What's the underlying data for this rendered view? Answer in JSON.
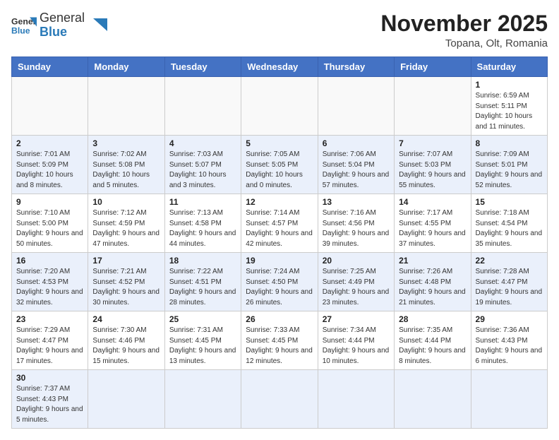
{
  "logo": {
    "text_general": "General",
    "text_blue": "Blue"
  },
  "title": "November 2025",
  "location": "Topana, Olt, Romania",
  "days_of_week": [
    "Sunday",
    "Monday",
    "Tuesday",
    "Wednesday",
    "Thursday",
    "Friday",
    "Saturday"
  ],
  "weeks": [
    [
      {
        "day": "",
        "info": ""
      },
      {
        "day": "",
        "info": ""
      },
      {
        "day": "",
        "info": ""
      },
      {
        "day": "",
        "info": ""
      },
      {
        "day": "",
        "info": ""
      },
      {
        "day": "",
        "info": ""
      },
      {
        "day": "1",
        "info": "Sunrise: 6:59 AM\nSunset: 5:11 PM\nDaylight: 10 hours and 11 minutes."
      }
    ],
    [
      {
        "day": "2",
        "info": "Sunrise: 7:01 AM\nSunset: 5:09 PM\nDaylight: 10 hours and 8 minutes."
      },
      {
        "day": "3",
        "info": "Sunrise: 7:02 AM\nSunset: 5:08 PM\nDaylight: 10 hours and 5 minutes."
      },
      {
        "day": "4",
        "info": "Sunrise: 7:03 AM\nSunset: 5:07 PM\nDaylight: 10 hours and 3 minutes."
      },
      {
        "day": "5",
        "info": "Sunrise: 7:05 AM\nSunset: 5:05 PM\nDaylight: 10 hours and 0 minutes."
      },
      {
        "day": "6",
        "info": "Sunrise: 7:06 AM\nSunset: 5:04 PM\nDaylight: 9 hours and 57 minutes."
      },
      {
        "day": "7",
        "info": "Sunrise: 7:07 AM\nSunset: 5:03 PM\nDaylight: 9 hours and 55 minutes."
      },
      {
        "day": "8",
        "info": "Sunrise: 7:09 AM\nSunset: 5:01 PM\nDaylight: 9 hours and 52 minutes."
      }
    ],
    [
      {
        "day": "9",
        "info": "Sunrise: 7:10 AM\nSunset: 5:00 PM\nDaylight: 9 hours and 50 minutes."
      },
      {
        "day": "10",
        "info": "Sunrise: 7:12 AM\nSunset: 4:59 PM\nDaylight: 9 hours and 47 minutes."
      },
      {
        "day": "11",
        "info": "Sunrise: 7:13 AM\nSunset: 4:58 PM\nDaylight: 9 hours and 44 minutes."
      },
      {
        "day": "12",
        "info": "Sunrise: 7:14 AM\nSunset: 4:57 PM\nDaylight: 9 hours and 42 minutes."
      },
      {
        "day": "13",
        "info": "Sunrise: 7:16 AM\nSunset: 4:56 PM\nDaylight: 9 hours and 39 minutes."
      },
      {
        "day": "14",
        "info": "Sunrise: 7:17 AM\nSunset: 4:55 PM\nDaylight: 9 hours and 37 minutes."
      },
      {
        "day": "15",
        "info": "Sunrise: 7:18 AM\nSunset: 4:54 PM\nDaylight: 9 hours and 35 minutes."
      }
    ],
    [
      {
        "day": "16",
        "info": "Sunrise: 7:20 AM\nSunset: 4:53 PM\nDaylight: 9 hours and 32 minutes."
      },
      {
        "day": "17",
        "info": "Sunrise: 7:21 AM\nSunset: 4:52 PM\nDaylight: 9 hours and 30 minutes."
      },
      {
        "day": "18",
        "info": "Sunrise: 7:22 AM\nSunset: 4:51 PM\nDaylight: 9 hours and 28 minutes."
      },
      {
        "day": "19",
        "info": "Sunrise: 7:24 AM\nSunset: 4:50 PM\nDaylight: 9 hours and 26 minutes."
      },
      {
        "day": "20",
        "info": "Sunrise: 7:25 AM\nSunset: 4:49 PM\nDaylight: 9 hours and 23 minutes."
      },
      {
        "day": "21",
        "info": "Sunrise: 7:26 AM\nSunset: 4:48 PM\nDaylight: 9 hours and 21 minutes."
      },
      {
        "day": "22",
        "info": "Sunrise: 7:28 AM\nSunset: 4:47 PM\nDaylight: 9 hours and 19 minutes."
      }
    ],
    [
      {
        "day": "23",
        "info": "Sunrise: 7:29 AM\nSunset: 4:47 PM\nDaylight: 9 hours and 17 minutes."
      },
      {
        "day": "24",
        "info": "Sunrise: 7:30 AM\nSunset: 4:46 PM\nDaylight: 9 hours and 15 minutes."
      },
      {
        "day": "25",
        "info": "Sunrise: 7:31 AM\nSunset: 4:45 PM\nDaylight: 9 hours and 13 minutes."
      },
      {
        "day": "26",
        "info": "Sunrise: 7:33 AM\nSunset: 4:45 PM\nDaylight: 9 hours and 12 minutes."
      },
      {
        "day": "27",
        "info": "Sunrise: 7:34 AM\nSunset: 4:44 PM\nDaylight: 9 hours and 10 minutes."
      },
      {
        "day": "28",
        "info": "Sunrise: 7:35 AM\nSunset: 4:44 PM\nDaylight: 9 hours and 8 minutes."
      },
      {
        "day": "29",
        "info": "Sunrise: 7:36 AM\nSunset: 4:43 PM\nDaylight: 9 hours and 6 minutes."
      }
    ],
    [
      {
        "day": "30",
        "info": "Sunrise: 7:37 AM\nSunset: 4:43 PM\nDaylight: 9 hours and 5 minutes."
      },
      {
        "day": "",
        "info": ""
      },
      {
        "day": "",
        "info": ""
      },
      {
        "day": "",
        "info": ""
      },
      {
        "day": "",
        "info": ""
      },
      {
        "day": "",
        "info": ""
      },
      {
        "day": "",
        "info": ""
      }
    ]
  ],
  "colors": {
    "header_bg": "#4472c4",
    "alt_row_bg": "#eaf0fb"
  }
}
